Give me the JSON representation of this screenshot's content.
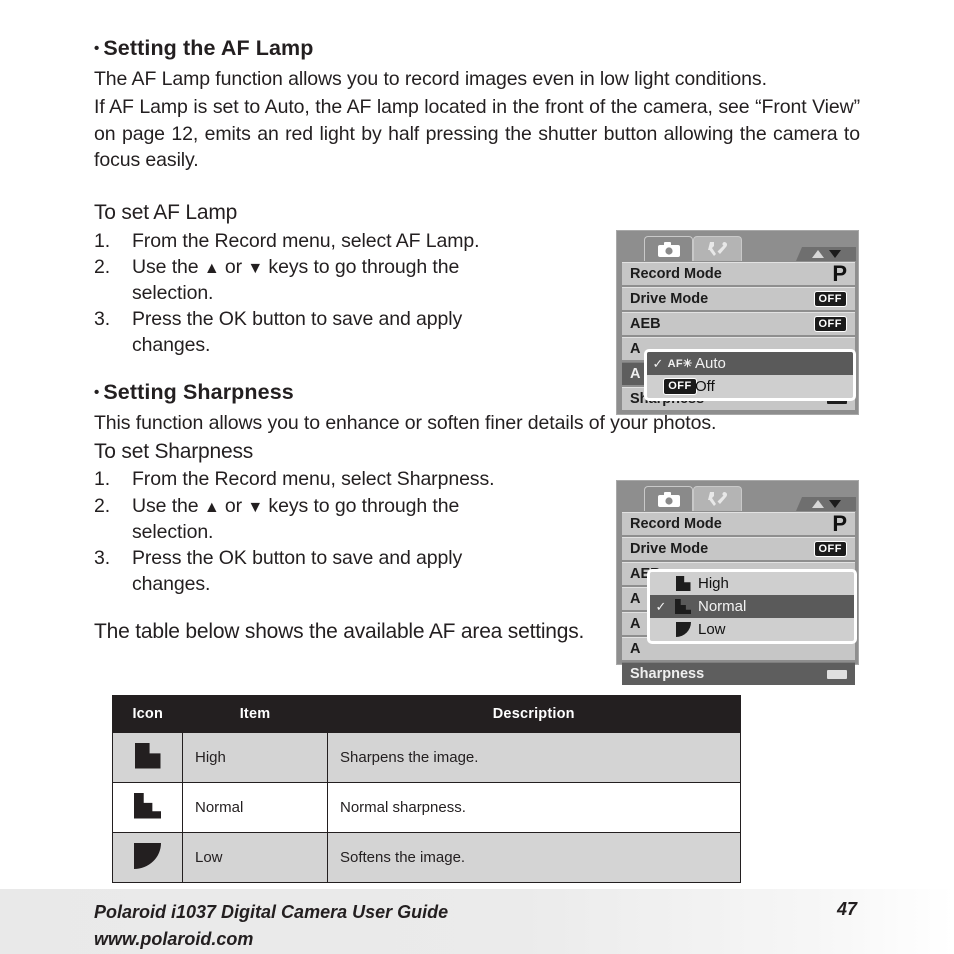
{
  "sections": {
    "af_lamp": {
      "bullet": "•",
      "heading": "Setting the AF Lamp",
      "para1": "The AF Lamp function allows you to record images even in low light conditions.",
      "para2": "If AF Lamp is set to Auto, the AF lamp located in the front of the camera, see “Front View” on page 12, emits an red light by half pressing the shutter button allowing the camera to focus easily.",
      "subhead": "To set AF Lamp",
      "steps": [
        {
          "num": "1.",
          "text": "From the Record menu, select AF Lamp."
        },
        {
          "num": "2.",
          "text_a": "Use the ",
          "arrow_up": "▲",
          "text_b": " or ",
          "arrow_down": "▼",
          "text_c": "  keys to go through the",
          "line2": "selection."
        },
        {
          "num": "3.",
          "text": "Press the OK button to save and apply",
          "line2": "changes."
        }
      ]
    },
    "sharpness": {
      "bullet": "•",
      "heading": "Setting Sharpness",
      "para1": "This function allows you to enhance or soften finer details of your photos.",
      "subhead": "To set Sharpness",
      "steps": [
        {
          "num": "1.",
          "text": "From the Record menu, select Sharpness."
        },
        {
          "num": "2.",
          "text_a": "Use the ",
          "arrow_up": "▲",
          "text_b": " or ",
          "arrow_down": "▼",
          "text_c": "  keys to go through the",
          "line2": "selection."
        },
        {
          "num": "3.",
          "text": "Press the OK button to save and apply",
          "line2": "changes."
        }
      ]
    },
    "table_intro": "The table below shows the available AF area settings."
  },
  "lcd_af": {
    "tabs": [
      {
        "name": "camera-tab",
        "icon": "camera-icon",
        "active": true
      },
      {
        "name": "setup-tab",
        "icon": "wrench-icon",
        "active": false
      }
    ],
    "scroll_up": "▲",
    "scroll_down": "▼",
    "rows": [
      {
        "label": "Record Mode",
        "value": "P",
        "value_type": "mode",
        "selected": false
      },
      {
        "label": "Drive Mode",
        "value": "OFF",
        "value_type": "badge",
        "selected": false
      },
      {
        "label": "AEB",
        "value": "OFF",
        "value_type": "badge",
        "selected": false
      },
      {
        "label": "A",
        "value": "",
        "value_type": "none",
        "selected": false
      },
      {
        "label": "A",
        "value": "",
        "value_type": "none",
        "selected": true
      },
      {
        "label": "Sharpness",
        "value": "",
        "value_type": "swatch",
        "selected": false
      }
    ],
    "popup": {
      "options": [
        {
          "check": "✓",
          "icon": "af-lamp-icon",
          "icon_text": "AF✳",
          "label": "Auto",
          "highlighted": true
        },
        {
          "check": "",
          "icon": "off-badge-icon",
          "icon_text": "OFF",
          "label": "Off",
          "highlighted": false
        }
      ]
    }
  },
  "lcd_sharp": {
    "tabs": [
      {
        "name": "camera-tab",
        "icon": "camera-icon",
        "active": true
      },
      {
        "name": "setup-tab",
        "icon": "wrench-icon",
        "active": false
      }
    ],
    "scroll_up": "▲",
    "scroll_down": "▼",
    "rows": [
      {
        "label": "Record Mode",
        "value": "P",
        "value_type": "mode",
        "selected": false
      },
      {
        "label": "Drive Mode",
        "value": "OFF",
        "value_type": "badge",
        "selected": false
      },
      {
        "label": "AEB",
        "value": "",
        "value_type": "none",
        "selected": false
      },
      {
        "label": "A",
        "value": "",
        "value_type": "none",
        "selected": false
      },
      {
        "label": "A",
        "value": "",
        "value_type": "none",
        "selected": false
      },
      {
        "label": "A",
        "value": "",
        "value_type": "none",
        "selected": false
      },
      {
        "label": "Sharpness",
        "value": "",
        "value_type": "swatch",
        "selected": true
      }
    ],
    "popup": {
      "options": [
        {
          "check": "",
          "icon": "sharpness-high-icon",
          "label": "High",
          "highlighted": false
        },
        {
          "check": "✓",
          "icon": "sharpness-normal-icon",
          "label": "Normal",
          "highlighted": true
        },
        {
          "check": "",
          "icon": "sharpness-low-icon",
          "label": "Low",
          "highlighted": false
        }
      ]
    }
  },
  "table": {
    "headers": {
      "icon": "Icon",
      "item": "Item",
      "description": "Description"
    },
    "rows": [
      {
        "icon": "sharpness-high-icon",
        "item": "High",
        "description": "Sharpens the image."
      },
      {
        "icon": "sharpness-normal-icon",
        "item": "Normal",
        "description": "Normal sharpness."
      },
      {
        "icon": "sharpness-low-icon",
        "item": "Low",
        "description": "Softens the image."
      }
    ]
  },
  "footer": {
    "line1": "Polaroid i1037 Digital Camera User Guide",
    "line2": "www.polaroid.com",
    "page_number": "47"
  },
  "colors": {
    "text": "#231f20",
    "table_header_bg": "#231f20",
    "table_shade": "#d4d4d4",
    "lcd_bg": "#8e8e8e",
    "lcd_row": "#c6c6c6",
    "lcd_row_selected": "#5e5e5e",
    "popup_bg": "#cfcfcf",
    "footer_bg": "#eaeaea"
  }
}
